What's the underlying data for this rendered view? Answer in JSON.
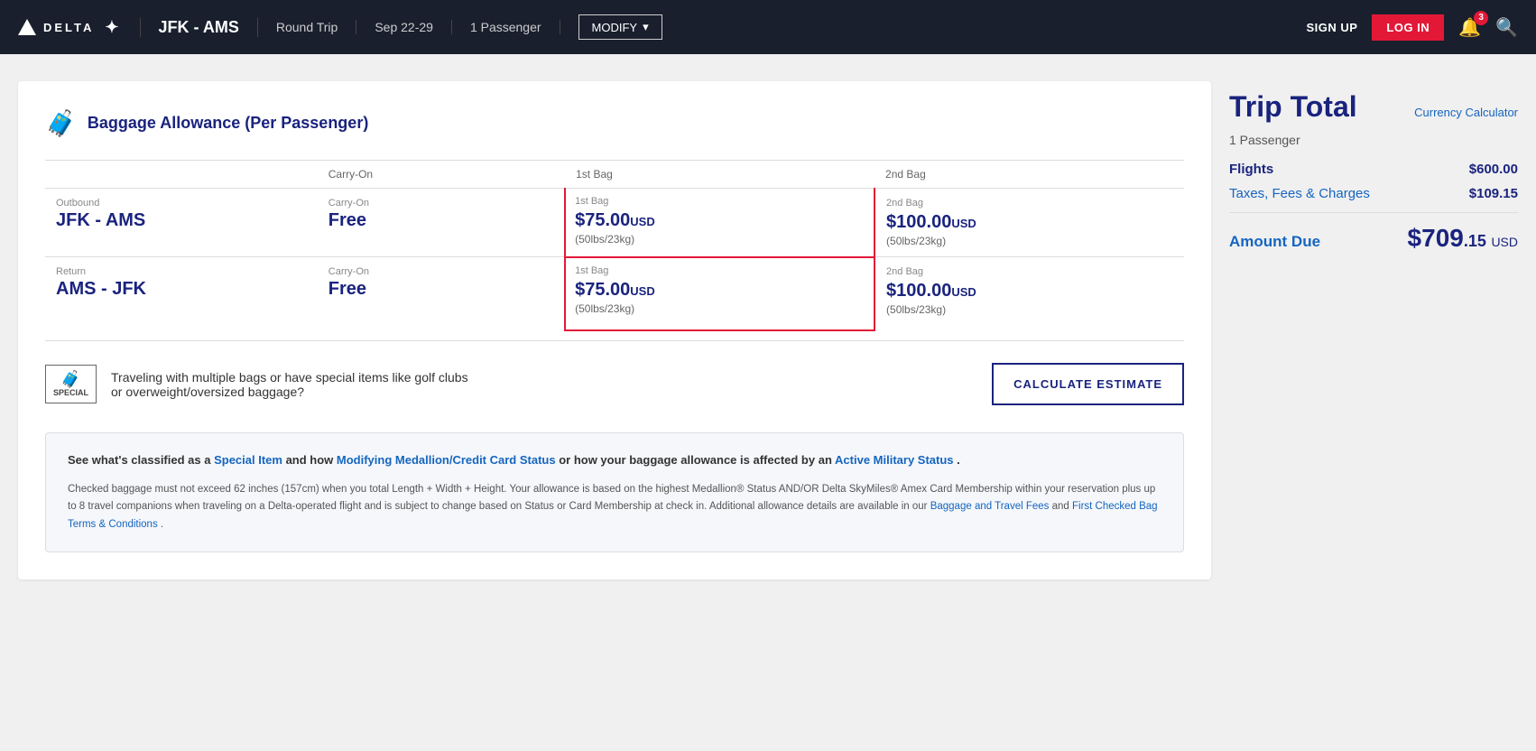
{
  "header": {
    "logo_text": "DELTA",
    "route": "JFK - AMS",
    "trip_type": "Round Trip",
    "dates": "Sep 22-29",
    "passengers": "1 Passenger",
    "modify_label": "MODIFY",
    "signup_label": "SIGN UP",
    "login_label": "LOG IN",
    "bell_count": "3"
  },
  "baggage": {
    "title": "Baggage Allowance (Per Passenger)",
    "col_route": "",
    "col_carryon": "Carry-On",
    "col_bag1": "1st Bag",
    "col_bag2": "2nd Bag",
    "outbound_label": "Outbound",
    "outbound_route": "JFK - AMS",
    "outbound_carryon_label": "Carry-On",
    "outbound_carryon": "Free",
    "outbound_bag1_label": "1st Bag",
    "outbound_bag1_price": "$75.00",
    "outbound_bag1_usd": "USD",
    "outbound_bag1_weight": "(50lbs/23kg)",
    "outbound_bag2_label": "2nd Bag",
    "outbound_bag2_price": "$100.00",
    "outbound_bag2_usd": "USD",
    "outbound_bag2_weight": "(50lbs/23kg)",
    "return_label": "Return",
    "return_route": "AMS - JFK",
    "return_carryon_label": "Carry-On",
    "return_carryon": "Free",
    "return_bag1_label": "1st Bag",
    "return_bag1_price": "$75.00",
    "return_bag1_usd": "USD",
    "return_bag1_weight": "(50lbs/23kg)",
    "return_bag2_label": "2nd Bag",
    "return_bag2_price": "$100.00",
    "return_bag2_usd": "USD",
    "return_bag2_weight": "(50lbs/23kg)",
    "special_icon_label": "SPECIAL",
    "special_text": "Traveling with multiple bags or have special items like golf clubs or overweight/oversized baggage?",
    "calculate_btn": "CALCULATE ESTIMATE",
    "info_title_1": "See what's classified as a ",
    "info_link_1": "Special Item",
    "info_title_2": " and how ",
    "info_link_2": "Modifying Medallion/Credit Card Status",
    "info_title_3": " or how your baggage allowance is affected by an ",
    "info_link_3": "Active Military Status",
    "info_title_4": " .",
    "info_body": "Checked baggage must not exceed 62 inches (157cm) when you total Length + Width + Height. Your allowance is based on the highest Medallion® Status AND/OR Delta SkyMiles® Amex Card Membership within your reservation plus up to 8 travel companions when traveling on a Delta-operated flight and is subject to change based on Status or Card Membership at check in. Additional allowance details are available in our ",
    "info_link_baggage": "Baggage and Travel Fees",
    "info_body_2": " and ",
    "info_link_terms": "First Checked Bag Terms & Conditions",
    "info_body_3": " ."
  },
  "trip_total": {
    "title": "Trip Total",
    "currency_calc": "Currency Calculator",
    "passengers": "1 Passenger",
    "flights_label": "Flights",
    "flights_value": "$600.00",
    "taxes_label": "Taxes, Fees & Charges",
    "taxes_value": "$109.15",
    "amount_due_label": "Amount Due",
    "amount_due_dollars": "$709",
    "amount_due_cents": ".15",
    "amount_due_currency": "USD"
  }
}
